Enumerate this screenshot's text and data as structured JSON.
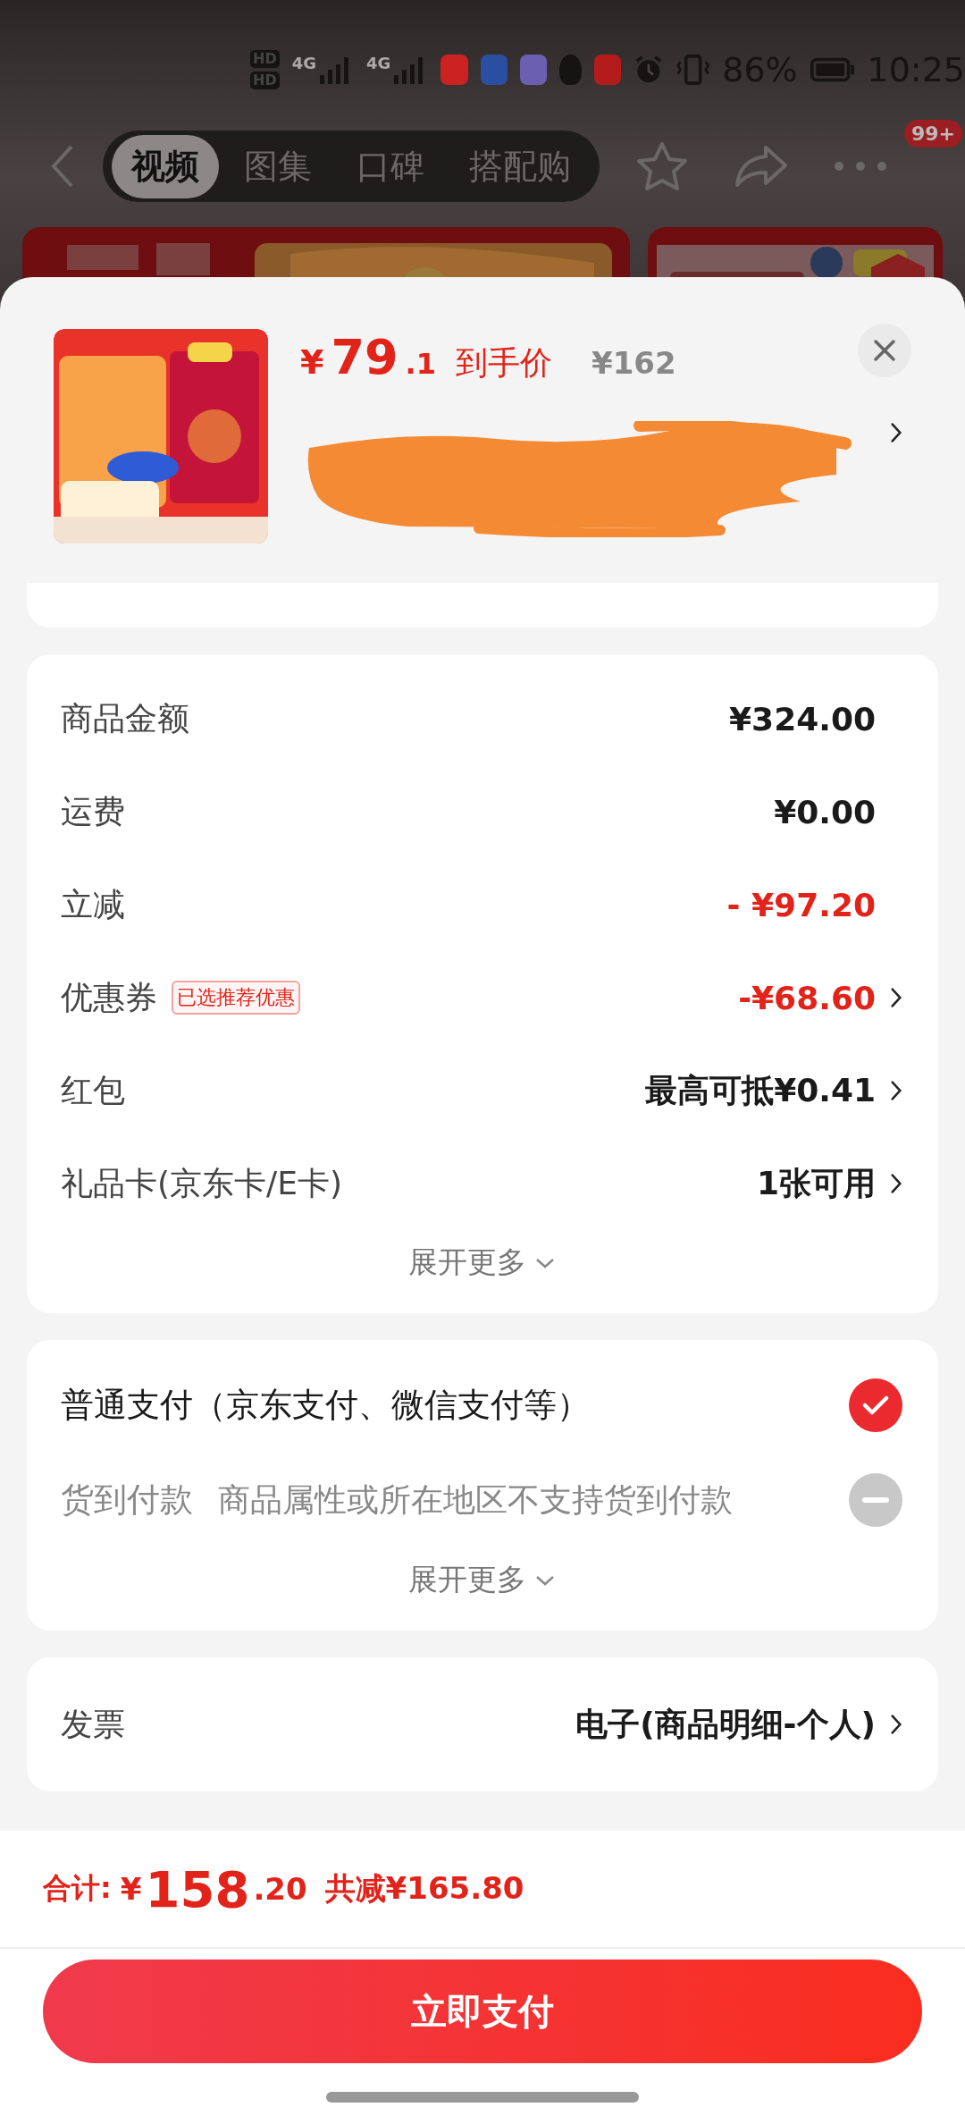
{
  "status_bar": {
    "sim_labels": [
      "HD",
      "HD"
    ],
    "network_labels": [
      "4G",
      "4G"
    ],
    "battery": "86%",
    "time": "10:25"
  },
  "nav": {
    "tabs": [
      {
        "label": "视频",
        "selected": true
      },
      {
        "label": "图集",
        "selected": false
      },
      {
        "label": "口碑",
        "selected": false
      },
      {
        "label": "搭配购",
        "selected": false
      }
    ],
    "badge": "99+"
  },
  "product": {
    "currency": "¥",
    "price_int": "79",
    "price_dec": ".1",
    "price_label": "到手价",
    "original_price": "¥162",
    "title_redacted": true
  },
  "fees": {
    "rows": [
      {
        "label": "商品金额",
        "value": "¥324.00",
        "kind": "normal",
        "arrow": false
      },
      {
        "label": "运费",
        "value": "¥0.00",
        "kind": "normal",
        "arrow": false
      },
      {
        "label": "立减",
        "value": "- ¥97.20",
        "kind": "discount",
        "arrow": false
      },
      {
        "label": "优惠券",
        "tag": "已选推荐优惠",
        "value": "-¥68.60",
        "kind": "discount",
        "arrow": true
      },
      {
        "label": "红包",
        "value": "最高可抵¥0.41",
        "kind": "normal",
        "arrow": true
      },
      {
        "label": "礼品卡(京东卡/E卡)",
        "value": "1张可用",
        "kind": "normal",
        "arrow": true
      }
    ],
    "expand": "展开更多"
  },
  "payment": {
    "options": [
      {
        "title": "普通支付（京东支付、微信支付等）",
        "selected": true,
        "disabled": false
      },
      {
        "title": "货到付款",
        "note": "商品属性或所在地区不支持货到付款",
        "selected": false,
        "disabled": true
      }
    ],
    "expand": "展开更多"
  },
  "invoice": {
    "label": "发票",
    "value": "电子(商品明细-个人)"
  },
  "footer": {
    "total_label": "合计:",
    "currency": "¥",
    "total_int": "158",
    "total_dec": ".20",
    "saved": "共减¥165.80",
    "pay_button": "立即支付"
  }
}
